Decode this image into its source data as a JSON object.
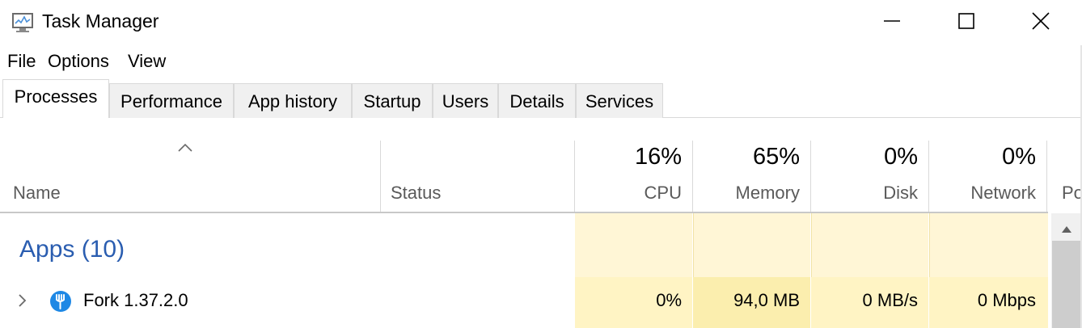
{
  "window": {
    "title": "Task Manager",
    "icon": "task-manager-icon",
    "controls": [
      "minimize-icon",
      "maximize-icon",
      "close-icon"
    ]
  },
  "menu": {
    "file": "File",
    "options": "Options",
    "view": "View"
  },
  "tabs": [
    {
      "label": "Processes",
      "active": true
    },
    {
      "label": "Performance",
      "active": false
    },
    {
      "label": "App history",
      "active": false
    },
    {
      "label": "Startup",
      "active": false
    },
    {
      "label": "Users",
      "active": false
    },
    {
      "label": "Details",
      "active": false
    },
    {
      "label": "Services",
      "active": false
    }
  ],
  "columns": {
    "name": {
      "label": "Name",
      "sorted": "ascending"
    },
    "status": {
      "label": "Status"
    },
    "cpu": {
      "label": "CPU",
      "percent": "16%"
    },
    "memory": {
      "label": "Memory",
      "percent": "65%"
    },
    "disk": {
      "label": "Disk",
      "percent": "0%"
    },
    "network": {
      "label": "Network",
      "percent": "0%"
    },
    "power": {
      "label": "Po"
    }
  },
  "groups": [
    {
      "title": "Apps (10)",
      "processes": [
        {
          "name": "Fork 1.37.2.0",
          "icon": "fork-icon",
          "status": "",
          "cpu": "0%",
          "memory": "94,0 MB",
          "disk": "0 MB/s",
          "network": "0 Mbps"
        }
      ]
    }
  ],
  "colors": {
    "group_title": "#2a5db0",
    "heat_light": "#fff4c4",
    "heat_memory": "#fbeeae"
  }
}
